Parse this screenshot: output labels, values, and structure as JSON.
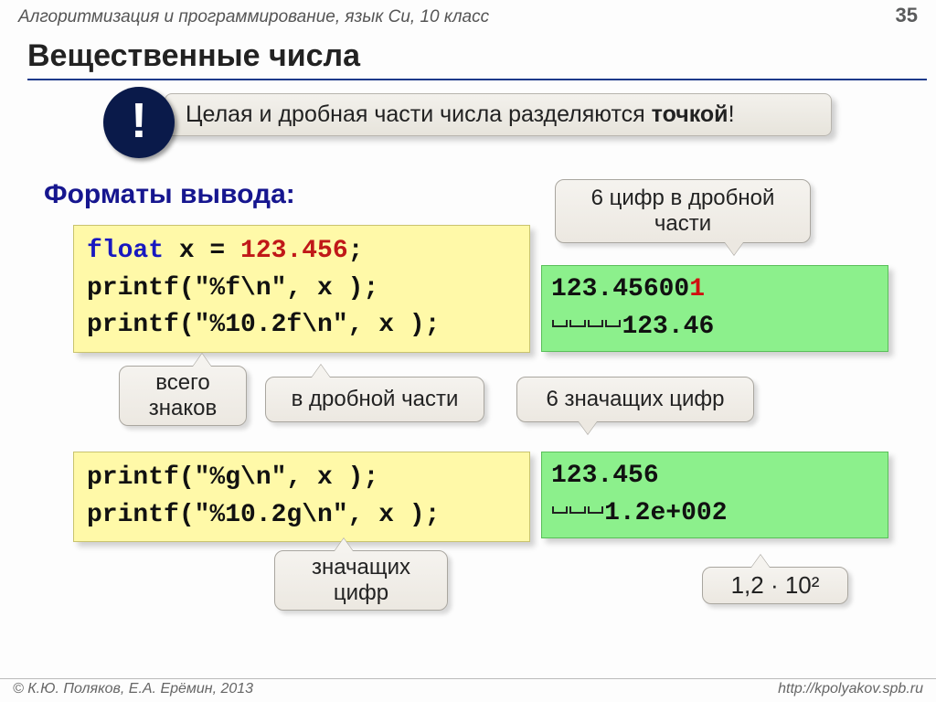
{
  "header": {
    "breadcrumb": "Алгоритмизация и программирование, язык Си, 10 класс",
    "page_number": "35"
  },
  "title": "Вещественные числа",
  "note": {
    "text_before": "Целая и дробная части числа разделяются ",
    "bold": "точкой",
    "after": "!",
    "disc": "!"
  },
  "section_label": "Форматы вывода:",
  "code1": {
    "l1_kw": "float",
    "l1_mid": " x = ",
    "l1_num": "123.456",
    "l1_end": ";",
    "l2": "printf(\"%f\\n\", x );",
    "l3": "printf(\"%10.2f\\n\", x );"
  },
  "out1": {
    "l1_pre": "123.45600",
    "l1_red": "1",
    "l2_spaces": 4,
    "l2_val": "123.46"
  },
  "callouts": {
    "six_frac": "6 цифр в дробной части",
    "total": "всего знаков",
    "in_frac": "в дробной части",
    "six_sig": "6 значащих цифр",
    "sig_digits": "значащих цифр",
    "sci": "1,2 · 10²"
  },
  "code2": {
    "l1": "printf(\"%g\\n\", x );",
    "l2": "printf(\"%10.2g\\n\", x );"
  },
  "out2": {
    "l1": "123.456",
    "l2_spaces": 3,
    "l2_val": "1.2e+002"
  },
  "footer": {
    "left": "© К.Ю. Поляков, Е.А. Ерёмин, 2013",
    "right": "http://kpolyakov.spb.ru"
  }
}
